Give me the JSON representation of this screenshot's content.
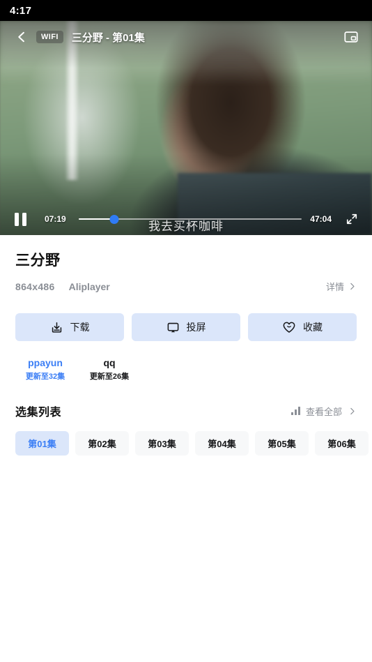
{
  "status_bar": {
    "clock": "4:17"
  },
  "player": {
    "back_icon": "chevron-left-icon",
    "network_badge": "WIFI",
    "title": "三分野 - 第01集",
    "pip_icon": "picture-in-picture-icon",
    "subtitle": "我去买杯咖啡",
    "play_state_icon": "pause-icon",
    "current_time": "07:19",
    "duration": "47:04",
    "progress_percent": 16,
    "fullscreen_icon": "fullscreen-icon",
    "accent": "#2f7bf5"
  },
  "info": {
    "title": "三分野",
    "resolution": "864x486",
    "player_name": "Aliplayer",
    "detail_label": "详情",
    "detail_chevron_icon": "chevron-right-icon"
  },
  "actions": [
    {
      "label": "下载",
      "icon": "download-icon"
    },
    {
      "label": "投屏",
      "icon": "cast-icon"
    },
    {
      "label": "收藏",
      "icon": "heart-icon"
    }
  ],
  "sources": [
    {
      "name": "ppayun",
      "status": "更新至32集",
      "selected": true
    },
    {
      "name": "qq",
      "status": "更新至26集",
      "selected": false
    }
  ],
  "episodes_section": {
    "title": "选集列表",
    "chart_icon": "bar-chart-icon",
    "view_all_label": "查看全部",
    "view_all_chevron_icon": "chevron-right-icon",
    "episodes": [
      {
        "label": "第01集",
        "selected": true
      },
      {
        "label": "第02集",
        "selected": false
      },
      {
        "label": "第03集",
        "selected": false
      },
      {
        "label": "第04集",
        "selected": false
      },
      {
        "label": "第05集",
        "selected": false
      },
      {
        "label": "第06集",
        "selected": false
      }
    ]
  },
  "colors": {
    "accent_blue": "#3b7ef5",
    "chip_bg": "#dbe6fa",
    "chip_idle_bg": "#f7f8f9",
    "muted_text": "#8a8e95"
  }
}
